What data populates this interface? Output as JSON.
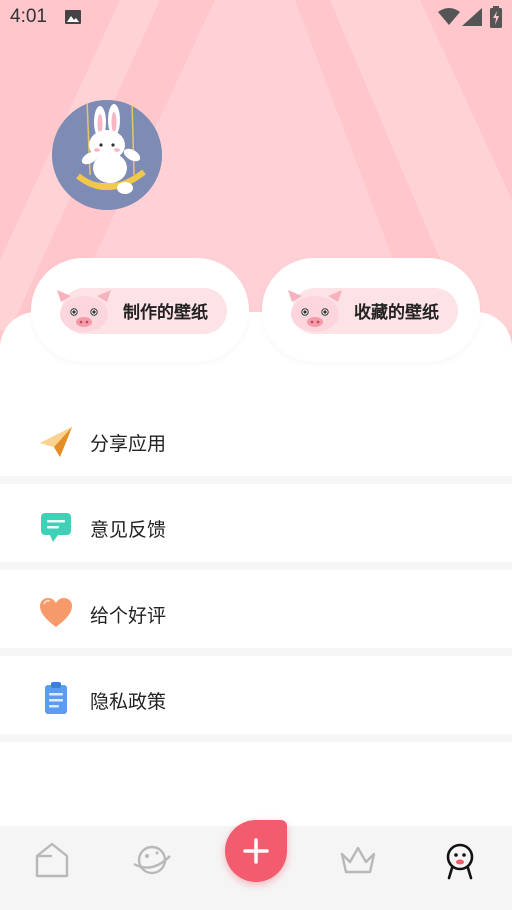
{
  "status_bar": {
    "time": "4:01"
  },
  "profile": {
    "avatar_icon": "bunny-on-swing-avatar"
  },
  "shortcuts": [
    {
      "label": "制作的壁纸",
      "icon": "pig-icon"
    },
    {
      "label": "收藏的壁纸",
      "icon": "pig-icon"
    }
  ],
  "menu": [
    {
      "label": "分享应用",
      "icon": "paper-plane-icon"
    },
    {
      "label": "意见反馈",
      "icon": "chat-bubble-icon"
    },
    {
      "label": "给个好评",
      "icon": "heart-icon"
    },
    {
      "label": "隐私政策",
      "icon": "clipboard-icon"
    }
  ],
  "bottom_nav": [
    {
      "icon": "home-icon"
    },
    {
      "icon": "planet-icon"
    },
    {
      "icon": "add-icon"
    },
    {
      "icon": "crown-icon"
    },
    {
      "icon": "profile-icon"
    }
  ],
  "colors": {
    "header_pink": "#ffc6cc",
    "accent": "#f25c6e",
    "chip_pink": "#fde3e6"
  }
}
